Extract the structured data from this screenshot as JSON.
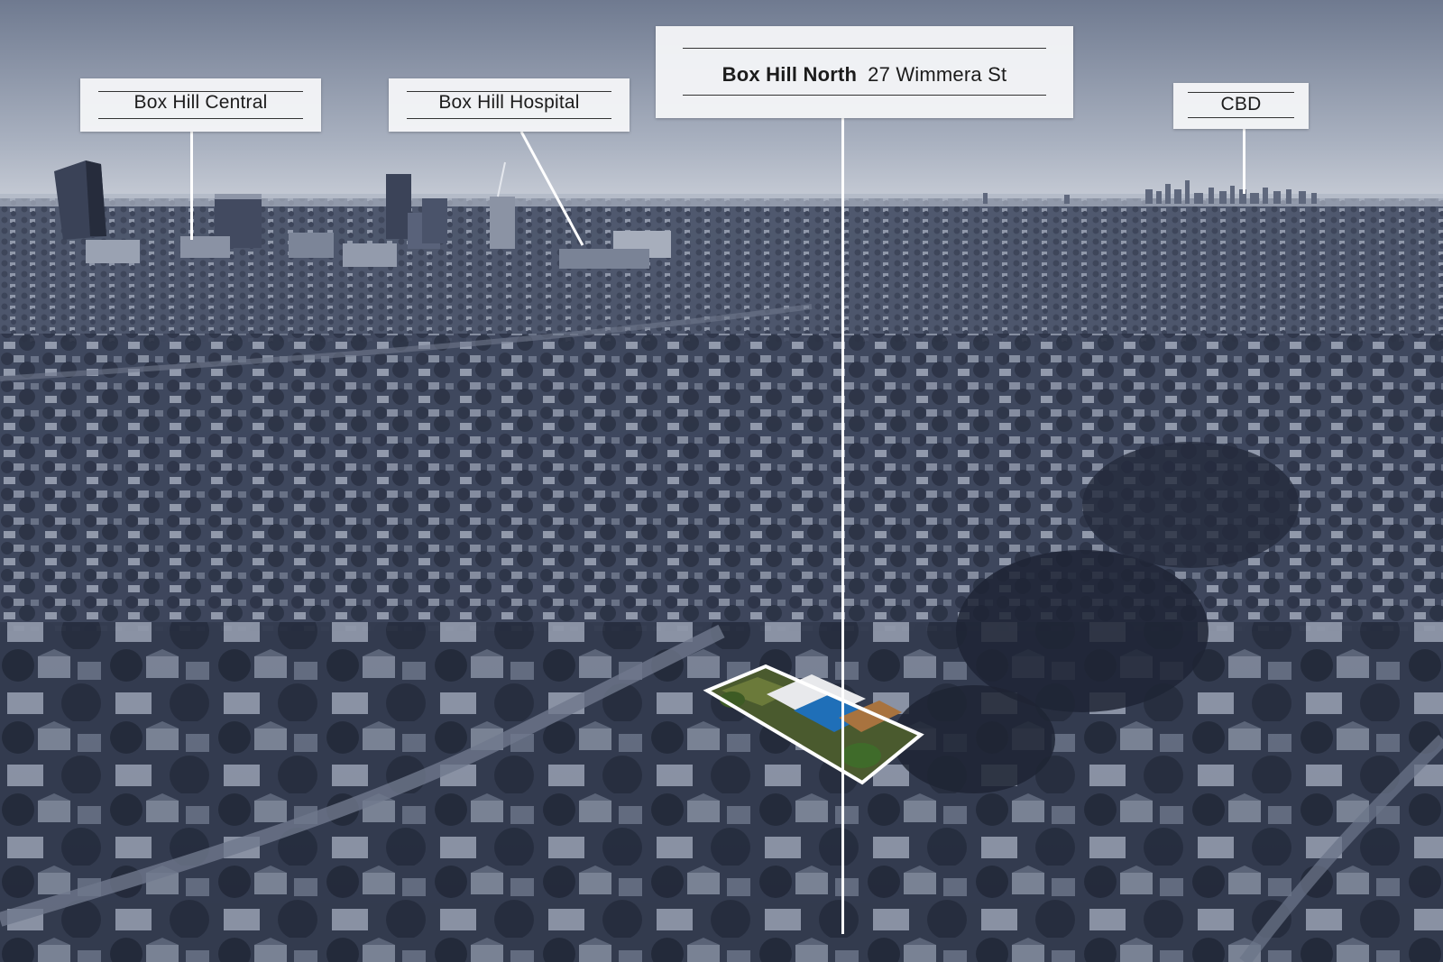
{
  "labels": {
    "central": "Box Hill Central",
    "hospital": "Box Hill Hospital",
    "main_suburb": "Box Hill North",
    "main_address": "27 Wimmera St",
    "cbd": "CBD"
  },
  "colors": {
    "sky": "#7c8699",
    "tint": "#3a4560",
    "label_bg": "#f4f5f7",
    "leader": "#ffffff",
    "highlight_border": "#ffffff"
  }
}
